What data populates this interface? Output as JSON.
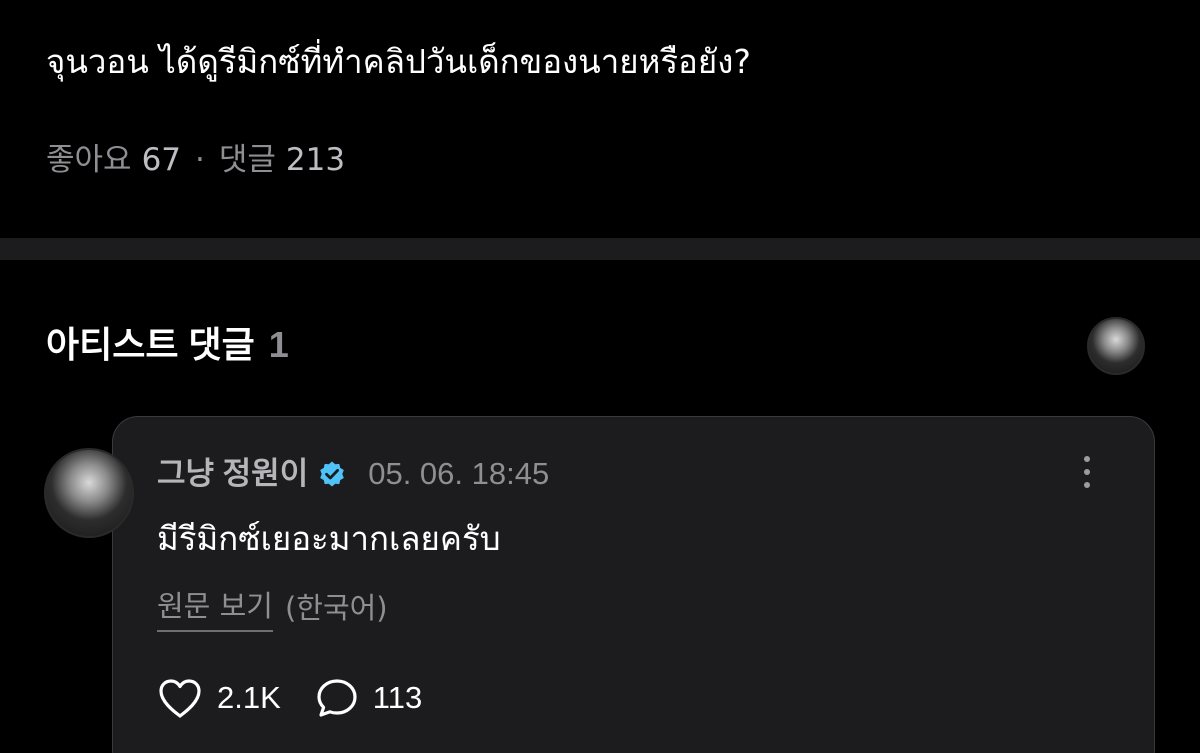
{
  "post": {
    "text": "จุนวอน ได้ดูรีมิกซ์ที่ทำคลิปวันเด็กของนายหรือยัง?",
    "likes_label": "좋아요",
    "likes_count": "67",
    "separator": "·",
    "comments_label": "댓글",
    "comments_count": "213"
  },
  "artist_comments": {
    "title": "아티스트 댓글",
    "count": "1",
    "header_avatar_icon": "artist-avatar"
  },
  "comment": {
    "author": "그냥 정원이",
    "verified_icon": "verified-badge-icon",
    "verified_color": "#4fc3f7",
    "timestamp": "05. 06. 18:45",
    "text": "มีรีมิกซ์เยอะมากเลยครับ",
    "view_original": "원문 보기",
    "original_language": "(한국어)",
    "likes": "2.1K",
    "replies": "113",
    "like_icon": "heart-icon",
    "reply_icon": "comment-bubble-icon",
    "more_icon": "more-vertical-icon"
  }
}
